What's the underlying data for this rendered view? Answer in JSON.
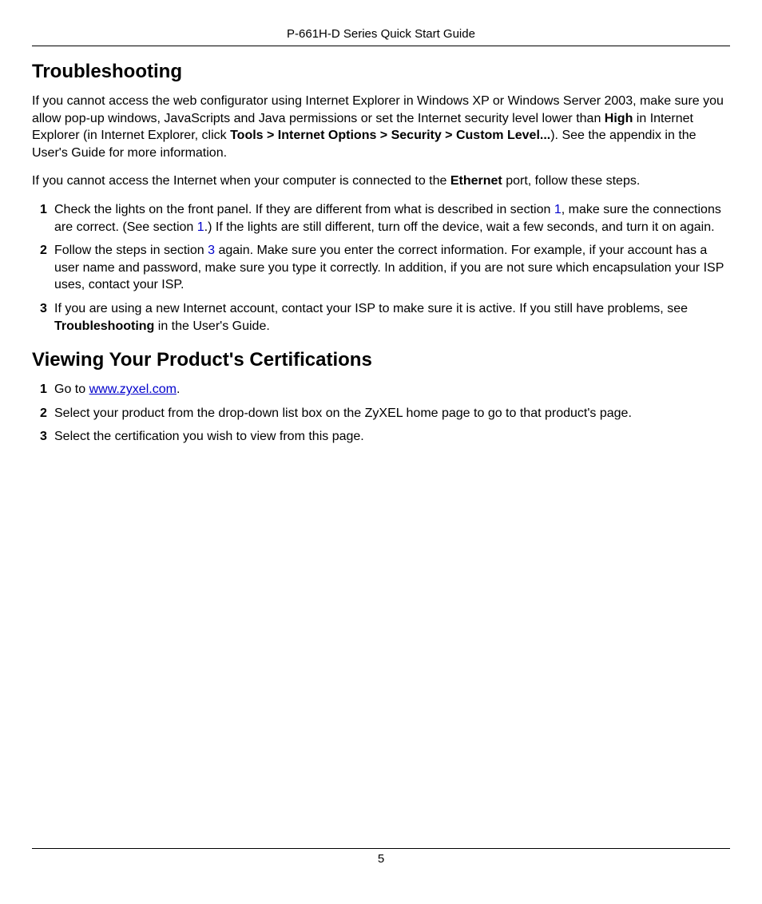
{
  "header": {
    "title": "P-661H-D Series Quick Start Guide"
  },
  "section1_heading": "Troubleshooting",
  "p1": {
    "s1": "If you cannot access the web configurator using Internet Explorer in Windows XP or Windows Server 2003, make sure you allow pop-up windows, JavaScripts and Java permissions or set the Internet security level lower than ",
    "b1": "High",
    "s2": " in Internet Explorer (in Internet Explorer, click ",
    "b2": "Tools > Internet Options > Security > Custom Level...",
    "s3": "). See the appendix in the User's Guide for more information."
  },
  "p2": {
    "s1": "If you cannot access the Internet when your computer is connected to the ",
    "b1": "Ethernet",
    "s2": " port, follow these steps."
  },
  "list1": {
    "n1": "1",
    "i1a": "Check the lights on the front panel. If they are different from what is described in section ",
    "i1x1": "1",
    "i1b": ", make sure the connections are correct. (See section ",
    "i1x2": "1",
    "i1c": ".) If the lights are still different, turn off the device, wait a few seconds, and turn it on again.",
    "n2": "2",
    "i2a": "Follow the steps in section ",
    "i2x1": "3",
    "i2b": " again. Make sure you enter the correct information. For example, if your account has a user name and password, make sure you type it correctly. In addition, if you are not sure which encapsulation your ISP uses, contact your ISP.",
    "n3": "3",
    "i3a": "If you are using a new Internet account, contact your ISP to make sure it is active. If you still have problems, see ",
    "i3b": "Troubleshooting",
    "i3c": " in the User's Guide."
  },
  "section2_heading": "Viewing Your Product's Certifications",
  "list2": {
    "n1": "1",
    "i1a": "Go to ",
    "i1link": "www.zyxel.com",
    "i1b": ".",
    "n2": "2",
    "i2": "Select your product from the drop-down list box on the ZyXEL home page to go to that product's page.",
    "n3": "3",
    "i3": "Select the certification you wish to view from this page."
  },
  "footer": {
    "page_number": "5"
  }
}
